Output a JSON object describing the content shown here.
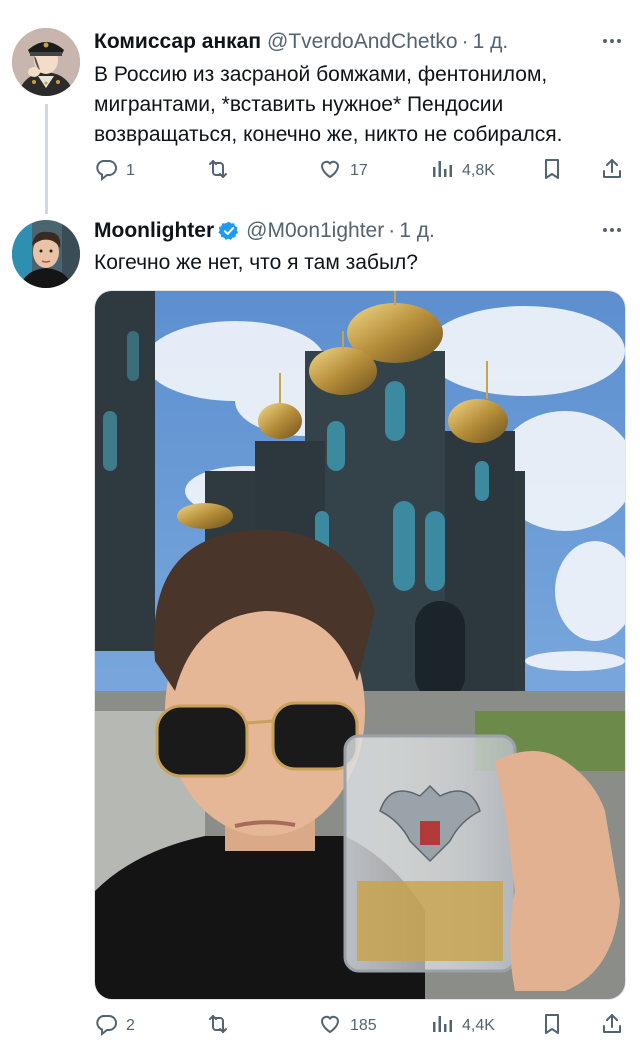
{
  "tweets": [
    {
      "author_name": "Комиссар анкап",
      "handle": "@TverdoAndChetko",
      "time": "1 д.",
      "verified": false,
      "text_lines": [
        "В Россию из засраной бомжами, фентонилом,",
        "мигрантами, *вставить нужное* Пендосии",
        "возвращаться, конечно же, никто не собирался."
      ],
      "stats": {
        "replies": "1",
        "retweets": "",
        "likes": "17",
        "views": "4,8K"
      }
    },
    {
      "author_name": "Moonlighter",
      "handle": "@M0on1ighter",
      "time": "1 д.",
      "verified": true,
      "text_lines": [
        "Когечно же нет, что я там забыл?"
      ],
      "stats": {
        "replies": "2",
        "retweets": "",
        "likes": "185",
        "views": "4,4K"
      }
    }
  ],
  "separator": "·",
  "icons": [
    "more-icon",
    "reply-icon",
    "retweet-icon",
    "like-icon",
    "views-icon",
    "bookmark-icon",
    "share-icon",
    "verified-badge-icon"
  ],
  "colors": {
    "text": "#0f1419",
    "secondary": "#536471",
    "verified": "#1d9bf0",
    "line": "#cfd9de"
  }
}
